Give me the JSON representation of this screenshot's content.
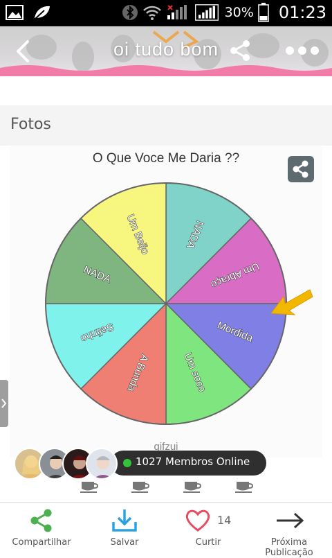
{
  "status_bar": {
    "battery_percent": "30%",
    "time": "01:23"
  },
  "header": {
    "title": "oi tudo bom"
  },
  "section": {
    "label": "Fotos"
  },
  "post_image": {
    "title": "O Que Voce Me Daria ??",
    "watermark": "gifzui",
    "wheel_segments": [
      {
        "label": "NADA",
        "color": "#7fd3c8"
      },
      {
        "label": "Um Abraço",
        "color": "#d96cc5"
      },
      {
        "label": "Mordida",
        "color": "#7f7fe6"
      },
      {
        "label": "Um soco",
        "color": "#7fe57f"
      },
      {
        "label": "A Bunda",
        "color": "#f07f73"
      },
      {
        "label": "Selinho",
        "color": "#7ff2ec"
      },
      {
        "label": "NADA",
        "color": "#7fb67f"
      },
      {
        "label": "Um Beijo",
        "color": "#f7f77f"
      }
    ],
    "pointer_color": "#f2b800"
  },
  "online": {
    "text": "1027 Membros Online",
    "status_color": "#34c23a"
  },
  "bottom_bar": {
    "share_label": "Compartilhar",
    "save_label": "Salvar",
    "like_label": "Curtir",
    "like_count": "14",
    "next_label": "Próxima Publicação",
    "accent_green": "#4caf50",
    "accent_blue": "#29a3e0",
    "accent_red": "#e84a5f"
  }
}
